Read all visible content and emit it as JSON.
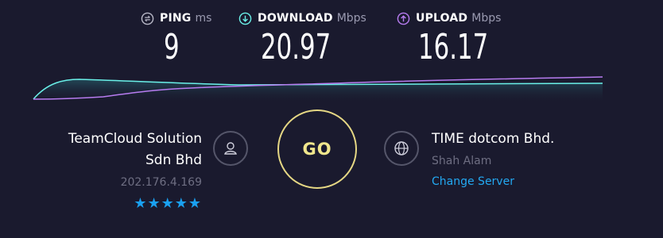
{
  "metrics": {
    "ping": {
      "label": "PING",
      "unit": "ms",
      "value": "9",
      "icon": "ping-icon",
      "color": "#b7b7c6"
    },
    "download": {
      "label": "DOWNLOAD",
      "unit": "Mbps",
      "value": "20.97",
      "icon": "download-icon",
      "color": "#6af0e8"
    },
    "upload": {
      "label": "UPLOAD",
      "unit": "Mbps",
      "value": "16.17",
      "icon": "upload-icon",
      "color": "#b77cf0"
    }
  },
  "isp": {
    "name_line1": "TeamCloud Solution",
    "name_line2": "Sdn Bhd",
    "ip": "202.176.4.169",
    "rating": "★★★★★",
    "icon": "user-icon"
  },
  "go_label": "GO",
  "server": {
    "name": "TIME dotcom Bhd.",
    "location": "Shah Alam",
    "change_label": "Change Server",
    "icon": "globe-icon"
  },
  "colors": {
    "background": "#1a1a2e",
    "download_line": "#6af0e8",
    "upload_line": "#b77cf0",
    "go_ring": "#e5d784",
    "link": "#23a9f2",
    "rating": "#1aa0f0"
  }
}
